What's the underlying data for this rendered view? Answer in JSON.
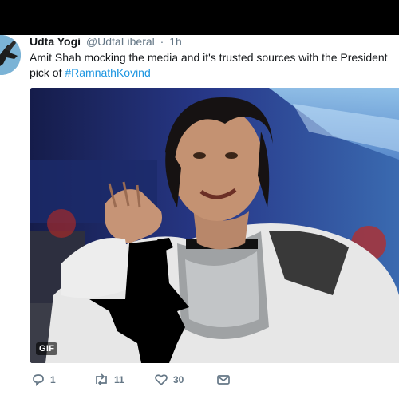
{
  "tweet": {
    "display_name": "Udta Yogi",
    "handle": "@UdtaLiberal",
    "separator": "·",
    "time": "1h",
    "text_prefix": "Amit Shah mocking the media and it's trusted sources with the President pick of ",
    "hashtag": "#RamnathKovind"
  },
  "media": {
    "badge": "GIF"
  },
  "actions": {
    "reply_count": "1",
    "retweet_count": "11",
    "like_count": "30"
  },
  "icons": {
    "reply": "reply-icon",
    "retweet": "retweet-icon",
    "like": "like-icon",
    "dm": "direct-message-icon"
  },
  "colors": {
    "hashtag": "#1b95e0",
    "secondary_text": "#657786",
    "top_bar": "#000000"
  }
}
